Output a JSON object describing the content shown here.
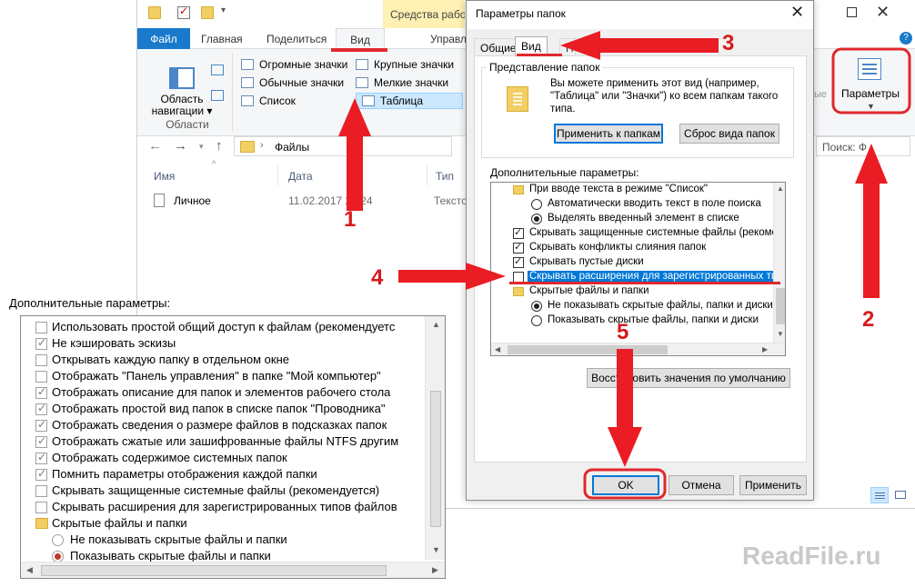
{
  "explorer": {
    "context_tab": "Средства работы",
    "tabs": {
      "file": "Файл",
      "home": "Главная",
      "share": "Поделиться",
      "view": "Вид",
      "manage": "Управл"
    },
    "ribbon": {
      "nav_pane_label": "Область навигации ▾",
      "group_areas": "Области",
      "layout_items": {
        "huge": "Огромные значки",
        "normal": "Обычные значки",
        "list": "Список",
        "large": "Крупные значки",
        "small": "Мелкие значки",
        "table": "Таблица"
      },
      "faded_text": "ые",
      "params_label": "Параметры"
    },
    "address": {
      "path": "Файлы"
    },
    "search_placeholder": "Поиск: Ф",
    "columns": {
      "name": "Имя",
      "date": "Дата",
      "type": "Тип"
    },
    "file": {
      "name": "Личное",
      "date": "11.02.2017 22:24",
      "type": "Тексто"
    }
  },
  "dialog": {
    "title": "Параметры папок",
    "tabs": {
      "general": "Общие",
      "view": "Вид",
      "search": "Поиск"
    },
    "folder_view_group": {
      "title": "Представление папок",
      "description": "Вы можете применить этот вид (например, \"Таблица\" или \"Значки\") ко всем папкам такого типа.",
      "apply_button": "Применить к папкам",
      "reset_button": "Сброс вида папок"
    },
    "advanced_label": "Дополнительные параметры:",
    "advanced_items": [
      {
        "kind": "folder",
        "label": "При вводе текста в режиме \"Список\""
      },
      {
        "kind": "radio",
        "checked": false,
        "label": "Автоматически вводить текст в поле поиска"
      },
      {
        "kind": "radio",
        "checked": true,
        "label": "Выделять введенный элемент в списке"
      },
      {
        "kind": "check",
        "checked": true,
        "label": "Скрывать защищенные системные файлы (рекомен"
      },
      {
        "kind": "check",
        "checked": true,
        "label": "Скрывать конфликты слияния папок"
      },
      {
        "kind": "check",
        "checked": true,
        "label": "Скрывать пустые диски"
      },
      {
        "kind": "check",
        "checked": false,
        "label": "Скрывать расширения для зарегистрированных типо"
      },
      {
        "kind": "folder",
        "label": "Скрытые файлы и папки"
      },
      {
        "kind": "radio",
        "checked": true,
        "label": "Не показывать скрытые файлы, папки и диски"
      },
      {
        "kind": "radio",
        "checked": false,
        "label": "Показывать скрытые файлы, папки и диски"
      }
    ],
    "restore_button": "Восстановить значения по умолчанию",
    "ok_button": "OK",
    "cancel_button": "Отмена",
    "apply_button": "Применить"
  },
  "zoom": {
    "label": "Дополнительные параметры:",
    "items": [
      {
        "kind": "check",
        "checked": false,
        "label": "Использовать простой общий доступ к файлам (рекомендуетс"
      },
      {
        "kind": "check",
        "checked": true,
        "label": "Не кэшировать эскизы"
      },
      {
        "kind": "check",
        "checked": false,
        "label": "Открывать каждую папку в отдельном окне"
      },
      {
        "kind": "check",
        "checked": false,
        "label": "Отображать \"Панель управления\" в папке \"Мой компьютер\""
      },
      {
        "kind": "check",
        "checked": true,
        "label": "Отображать описание для папок и элементов рабочего стола"
      },
      {
        "kind": "check",
        "checked": true,
        "label": "Отображать простой вид папок в списке папок \"Проводника\""
      },
      {
        "kind": "check",
        "checked": true,
        "label": "Отображать сведения о размере файлов в подсказках папок"
      },
      {
        "kind": "check",
        "checked": true,
        "label": "Отображать сжатые или зашифрованные файлы NTFS другим"
      },
      {
        "kind": "check",
        "checked": true,
        "label": "Отображать содержимое системных папок"
      },
      {
        "kind": "check",
        "checked": true,
        "label": "Помнить параметры отображения каждой папки"
      },
      {
        "kind": "check",
        "checked": false,
        "label": "Скрывать защищенные системные файлы (рекомендуется)"
      },
      {
        "kind": "check",
        "checked": false,
        "label": "Скрывать расширения для зарегистрированных типов файлов"
      },
      {
        "kind": "folder",
        "label": "Скрытые файлы и папки"
      },
      {
        "kind": "radio",
        "checked": false,
        "label": "Не показывать скрытые файлы и папки"
      },
      {
        "kind": "radio",
        "checked": true,
        "label": "Показывать скрытые файлы и папки"
      }
    ]
  },
  "annotations": {
    "n1": "1",
    "n2": "2",
    "n3": "3",
    "n4": "4",
    "n5": "5",
    "accent": "#ea1c24"
  },
  "watermark": "ReadFile.ru"
}
